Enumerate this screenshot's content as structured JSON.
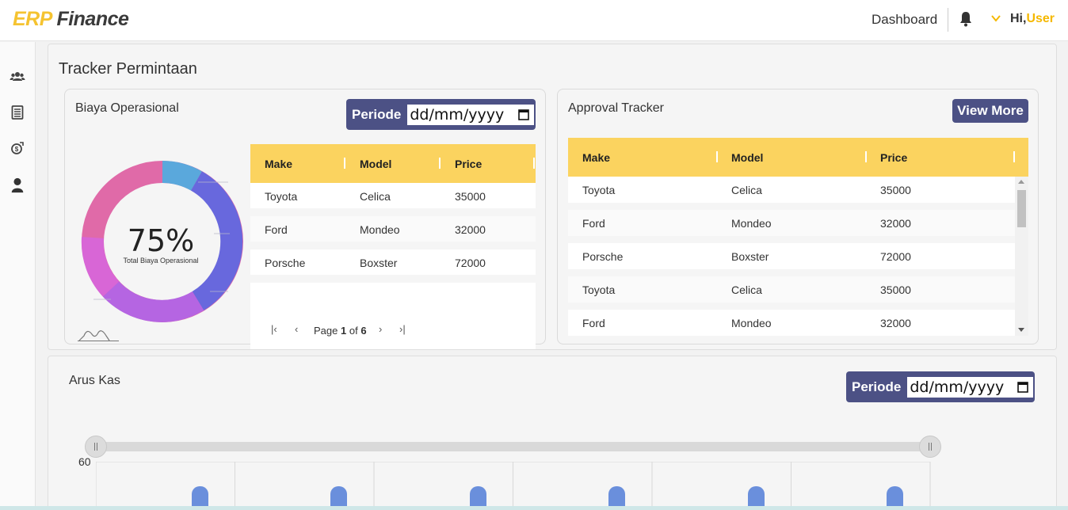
{
  "app": {
    "logo_part1": "ERP",
    "logo_part2": "Finance",
    "nav_dashboard": "Dashboard",
    "greeting_hi": "Hi,",
    "greeting_user": "User",
    "accent": "#f5c330",
    "primary": "#4c5185"
  },
  "sidebar": {
    "icons": [
      "users-icon",
      "ledger-icon",
      "money-icon",
      "person-icon"
    ]
  },
  "tracker": {
    "title": "Tracker Permintaan",
    "biaya": {
      "title": "Biaya Operasional",
      "periode_label": "Periode",
      "date_placeholder": "dd/mm/yyyy",
      "percent": "75%",
      "percent_caption": "Total Biaya Operasional",
      "table": {
        "headers": [
          "Make",
          "Model",
          "Price"
        ],
        "rows": [
          [
            "Toyota",
            "Celica",
            "35000"
          ],
          [
            "Ford",
            "Mondeo",
            "32000"
          ],
          [
            "Porsche",
            "Boxster",
            "72000"
          ]
        ]
      },
      "pager": {
        "page_word": "Page",
        "current": "1",
        "of_word": "of",
        "total": "6"
      }
    },
    "approval": {
      "title": "Approval Tracker",
      "view_more": "View More",
      "table": {
        "headers": [
          "Make",
          "Model",
          "Price"
        ],
        "rows": [
          [
            "Toyota",
            "Celica",
            "35000"
          ],
          [
            "Ford",
            "Mondeo",
            "32000"
          ],
          [
            "Porsche",
            "Boxster",
            "72000"
          ],
          [
            "Toyota",
            "Celica",
            "35000"
          ],
          [
            "Ford",
            "Mondeo",
            "32000"
          ]
        ]
      }
    }
  },
  "arus_kas": {
    "title": "Arus Kas",
    "periode_label": "Periode",
    "date_placeholder": "dd/mm/yyyy",
    "y_tick_top": "60"
  }
}
